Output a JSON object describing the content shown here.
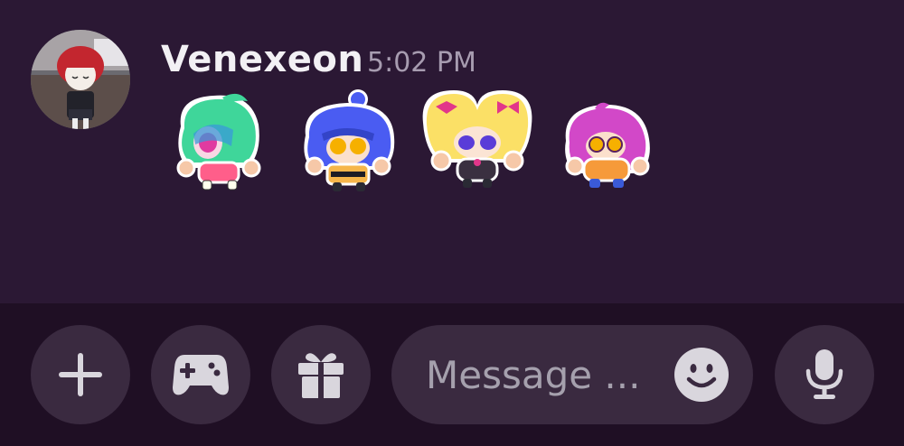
{
  "message": {
    "author": "Venexeon",
    "timestamp": "5:02 PM",
    "avatar_icon": "user-avatar",
    "stickers": [
      {
        "icon": "green-hair-chibi-sticker",
        "hair": "#3fd69a",
        "outfit": "#ff5e8a"
      },
      {
        "icon": "blue-hair-chibi-sticker",
        "hair": "#4a5cf2",
        "outfit": "#f6b64a"
      },
      {
        "icon": "blonde-hair-chibi-sticker",
        "hair": "#fbe066",
        "outfit": "#3a3040"
      },
      {
        "icon": "pink-hair-chibi-sticker",
        "hair": "#d248c8",
        "outfit": "#f69a3a"
      }
    ]
  },
  "composer": {
    "buttons": [
      {
        "name": "add-attachment-button",
        "icon": "plus-icon"
      },
      {
        "name": "activities-button",
        "icon": "gamepad-icon"
      },
      {
        "name": "gift-button",
        "icon": "gift-icon"
      }
    ],
    "placeholder": "Message ...",
    "emoji_icon": "smiley-icon",
    "voice_icon": "microphone-icon"
  },
  "colors": {
    "background": "#2b1834",
    "composer_bg": "#1f0f24",
    "button_bg": "#3a2a40",
    "icon": "#d9d6dd",
    "username": "#f2f0f4",
    "timestamp": "#a79cb0"
  }
}
